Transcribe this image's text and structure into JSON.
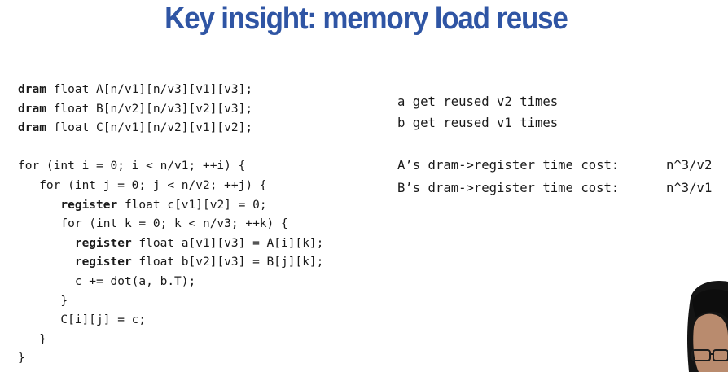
{
  "slide": {
    "title": "Key insight: memory load reuse"
  },
  "code": {
    "lines": [
      [
        {
          "t": "dram",
          "b": true
        },
        {
          "t": " float A[n/v1][n/v3][v1][v3];"
        }
      ],
      [
        {
          "t": "dram",
          "b": true
        },
        {
          "t": " float B[n/v2][n/v3][v2][v3];"
        }
      ],
      [
        {
          "t": "dram",
          "b": true
        },
        {
          "t": " float C[n/v1][n/v2][v1][v2];"
        }
      ],
      [
        {
          "t": ""
        }
      ],
      [
        {
          "t": "for (int i = 0; i < n/v1; ++i) {"
        }
      ],
      [
        {
          "t": "   for (int j = 0; j < n/v2; ++j) {"
        }
      ],
      [
        {
          "t": "      "
        },
        {
          "t": "register",
          "b": true
        },
        {
          "t": " float c[v1][v2] = 0;"
        }
      ],
      [
        {
          "t": "      for (int k = 0; k < n/v3; ++k) {"
        }
      ],
      [
        {
          "t": "        "
        },
        {
          "t": "register",
          "b": true
        },
        {
          "t": " float a[v1][v3] = A[i][k];"
        }
      ],
      [
        {
          "t": "        "
        },
        {
          "t": "register",
          "b": true
        },
        {
          "t": " float b[v2][v3] = B[j][k];"
        }
      ],
      [
        {
          "t": "        c += dot(a, b.T);"
        }
      ],
      [
        {
          "t": "      }"
        }
      ],
      [
        {
          "t": "      C[i][j] = c;"
        }
      ],
      [
        {
          "t": "   }"
        }
      ],
      [
        {
          "t": "}"
        }
      ]
    ]
  },
  "notes": {
    "reuse_a": "a get reused v2 times",
    "reuse_b": "b get reused v1 times",
    "cost_a_label": "A’s dram->register time cost:",
    "cost_a_value": "n^3/v2",
    "cost_b_label": "B’s dram->register time cost:",
    "cost_b_value": "n^3/v1"
  },
  "colors": {
    "title": "#2f55a4",
    "text": "#1a1a1a"
  }
}
